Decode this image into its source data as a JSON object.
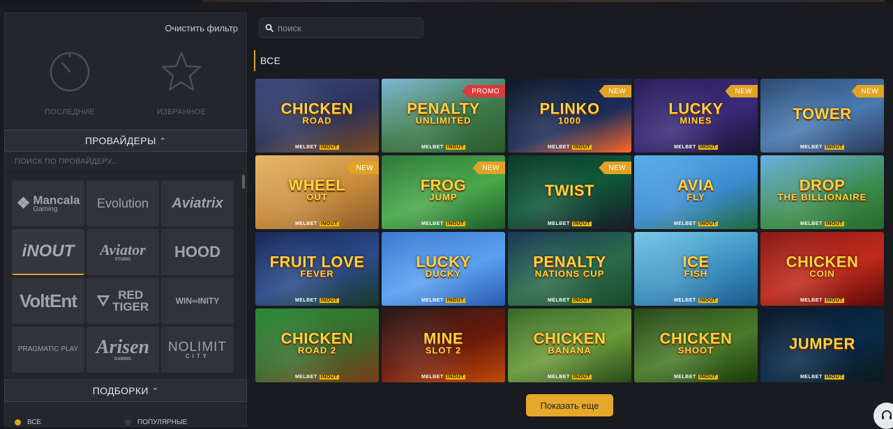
{
  "sidebar": {
    "clear_filter": "Очистить фильтр",
    "recent_label": "ПОСЛЕДНИЕ",
    "favorites_label": "ИЗБРАННОЕ",
    "providers_header": "ПРОВАЙДЕРЫ",
    "provider_search_placeholder": "ПОИСК ПО ПРОВАЙДЕРУ...",
    "providers": [
      {
        "name": "Mancala Gaming",
        "line1": "Mancala",
        "line2": "Gaming"
      },
      {
        "name": "Evolution",
        "line1": "Evolution",
        "line2": ""
      },
      {
        "name": "Aviatrix",
        "line1": "Aviatrix",
        "line2": ""
      },
      {
        "name": "InOut",
        "line1": "iNOUT",
        "line2": ""
      },
      {
        "name": "Aviator",
        "line1": "Aviator",
        "line2": "STUDIO"
      },
      {
        "name": "The Hood",
        "line1": "HOOD",
        "line2": ""
      },
      {
        "name": "Volt Ent",
        "line1": "VoltEnt",
        "line2": ""
      },
      {
        "name": "Red Tiger",
        "line1": "RED",
        "line2": "TIGER"
      },
      {
        "name": "Wininfinity",
        "line1": "WIN∞INITY",
        "line2": ""
      },
      {
        "name": "Pragmatic Play",
        "line1": "PRAGMATIC PLAY",
        "line2": ""
      },
      {
        "name": "Arisen",
        "line1": "Arisen",
        "line2": "GAMING"
      },
      {
        "name": "Nolimit City",
        "line1": "NOLIMIT",
        "line2": "CITY"
      }
    ],
    "collections_header": "ПОДБОРКИ",
    "collection_all": "ВСЕ",
    "collection_popular": "ПОПУЛЯРНЫЕ"
  },
  "search": {
    "placeholder": "поиск"
  },
  "section_title": "ВСЕ",
  "games": [
    {
      "title": "CHICKEN",
      "sub": "ROAD",
      "badge": "",
      "bg": "linear-gradient(160deg,#3d4a7a,#2a3159 55%,#7a4a22)"
    },
    {
      "title": "PENALTY",
      "sub": "UNLIMITED",
      "badge": "PROMO",
      "bg": "linear-gradient(160deg,#7fb7d6,#3c7a4a 55%,#2d5a2f)"
    },
    {
      "title": "PLINKO",
      "sub": "1000",
      "badge": "NEW",
      "bg": "linear-gradient(160deg,#101a2a,#1e2e5a 60%,#ff6a2a)"
    },
    {
      "title": "LUCKY",
      "sub": "MINES",
      "badge": "NEW",
      "bg": "linear-gradient(160deg,#2a1f5a,#3b2a7a 55%,#1a1436)"
    },
    {
      "title": "TOWER",
      "sub": "",
      "badge": "NEW",
      "bg": "linear-gradient(160deg,#2b4a72,#4a7ab0 55%,#2a3a5a)"
    },
    {
      "title": "WHEEL",
      "sub": "OUT",
      "badge": "NEW",
      "bg": "linear-gradient(160deg,#e8b86a,#c78a3a 55%,#8a5a2a)"
    },
    {
      "title": "FROG",
      "sub": "JUMP",
      "badge": "NEW",
      "bg": "linear-gradient(160deg,#2d7a3a,#4aa84a 55%,#1d5a2a)"
    },
    {
      "title": "TWIST",
      "sub": "",
      "badge": "NEW",
      "bg": "linear-gradient(160deg,#0d3a2a,#0f5a3a 50%,#1a1a2a)"
    },
    {
      "title": "AVIA",
      "sub": "FLY",
      "badge": "",
      "bg": "linear-gradient(160deg,#5ab0e8,#3a8ad0 55%,#1f6a3a)"
    },
    {
      "title": "DROP",
      "sub": "THE BILLIONAIRE",
      "badge": "",
      "bg": "linear-gradient(160deg,#6ab0e0,#3a8a4a 60%,#2a6a2a)"
    },
    {
      "title": "FRUIT LOVE",
      "sub": "FEVER",
      "badge": "",
      "bg": "linear-gradient(160deg,#1a2a5a,#2a4a8a 55%,#1a3a2a)"
    },
    {
      "title": "LUCKY",
      "sub": "DUCKY",
      "badge": "",
      "bg": "linear-gradient(160deg,#3a7ad0,#5aa0f0 55%,#2a5ab0)"
    },
    {
      "title": "PENALTY",
      "sub": "NATIONS CUP",
      "badge": "",
      "bg": "linear-gradient(160deg,#1a3a5a,#2a6a4a 55%,#1a4a2a)"
    },
    {
      "title": "ICE",
      "sub": "FISH",
      "badge": "",
      "bg": "linear-gradient(160deg,#7ac8e8,#3a90c0 55%,#1a5a8a)"
    },
    {
      "title": "CHICKEN",
      "sub": "COIN",
      "badge": "",
      "bg": "linear-gradient(160deg,#8a1a1a,#c02a1a 55%,#5a0a0a)"
    },
    {
      "title": "CHICKEN",
      "sub": "ROAD 2",
      "badge": "",
      "bg": "linear-gradient(160deg,#2a8a3a,#3a6a2a 55%,#7a3a1a)"
    },
    {
      "title": "MINE",
      "sub": "SLOT 2",
      "badge": "",
      "bg": "linear-gradient(160deg,#2a1a1a,#6a1a0a 55%,#c04a0a)"
    },
    {
      "title": "CHICKEN",
      "sub": "BANANA",
      "badge": "",
      "bg": "linear-gradient(160deg,#3a6a2a,#6a9a3a 55%,#2a4a1a)"
    },
    {
      "title": "CHICKEN",
      "sub": "SHOOT",
      "badge": "",
      "bg": "linear-gradient(160deg,#2a4a1a,#4a7a2a 55%,#1a3a0a)"
    },
    {
      "title": "JUMPER",
      "sub": "",
      "badge": "",
      "bg": "linear-gradient(160deg,#0a1a2a,#0a2a4a 55%,#0a1a1a)"
    }
  ],
  "brand_text": "MELBET",
  "brand_tag": "INOUT",
  "show_more": "Показать еще",
  "colors": {
    "accent": "#e2a325",
    "promo": "#d83b3b",
    "sidebar_bg": "#23262d",
    "page_bg": "#191b20"
  }
}
